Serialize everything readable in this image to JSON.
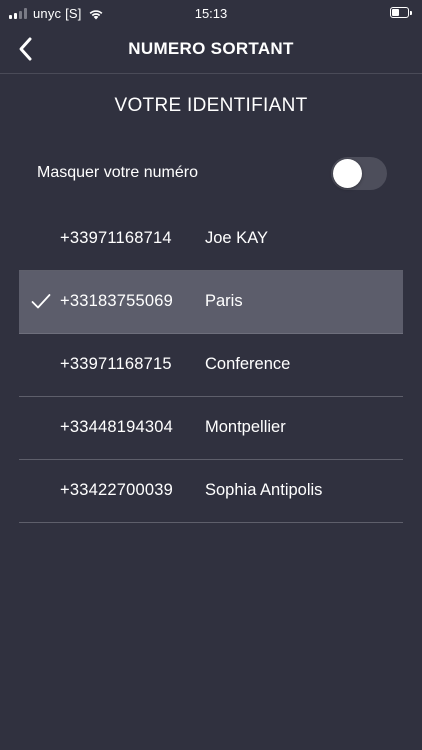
{
  "status": {
    "carrier": "unyc [S]",
    "time": "15:13",
    "battery_level": 0.45
  },
  "nav": {
    "title": "NUMERO SORTANT",
    "back_icon": "chevron-left-icon"
  },
  "section_title": "VOTRE IDENTIFIANT",
  "mask": {
    "label": "Masquer votre numéro",
    "enabled": false
  },
  "numbers": [
    {
      "number": "+33971168714",
      "label": "Joe KAY",
      "selected": false
    },
    {
      "number": "+33183755069",
      "label": "Paris",
      "selected": true
    },
    {
      "number": "+33971168715",
      "label": "Conference",
      "selected": false
    },
    {
      "number": "+33448194304",
      "label": "Montpellier",
      "selected": false
    },
    {
      "number": "+33422700039",
      "label": "Sophia Antipolis",
      "selected": false
    }
  ],
  "colors": {
    "background": "#30313f",
    "selected_row": "#5c5d6b",
    "separator": "#5e5f6b",
    "toggle_off": "#4d4e5b",
    "text": "#ffffff"
  }
}
